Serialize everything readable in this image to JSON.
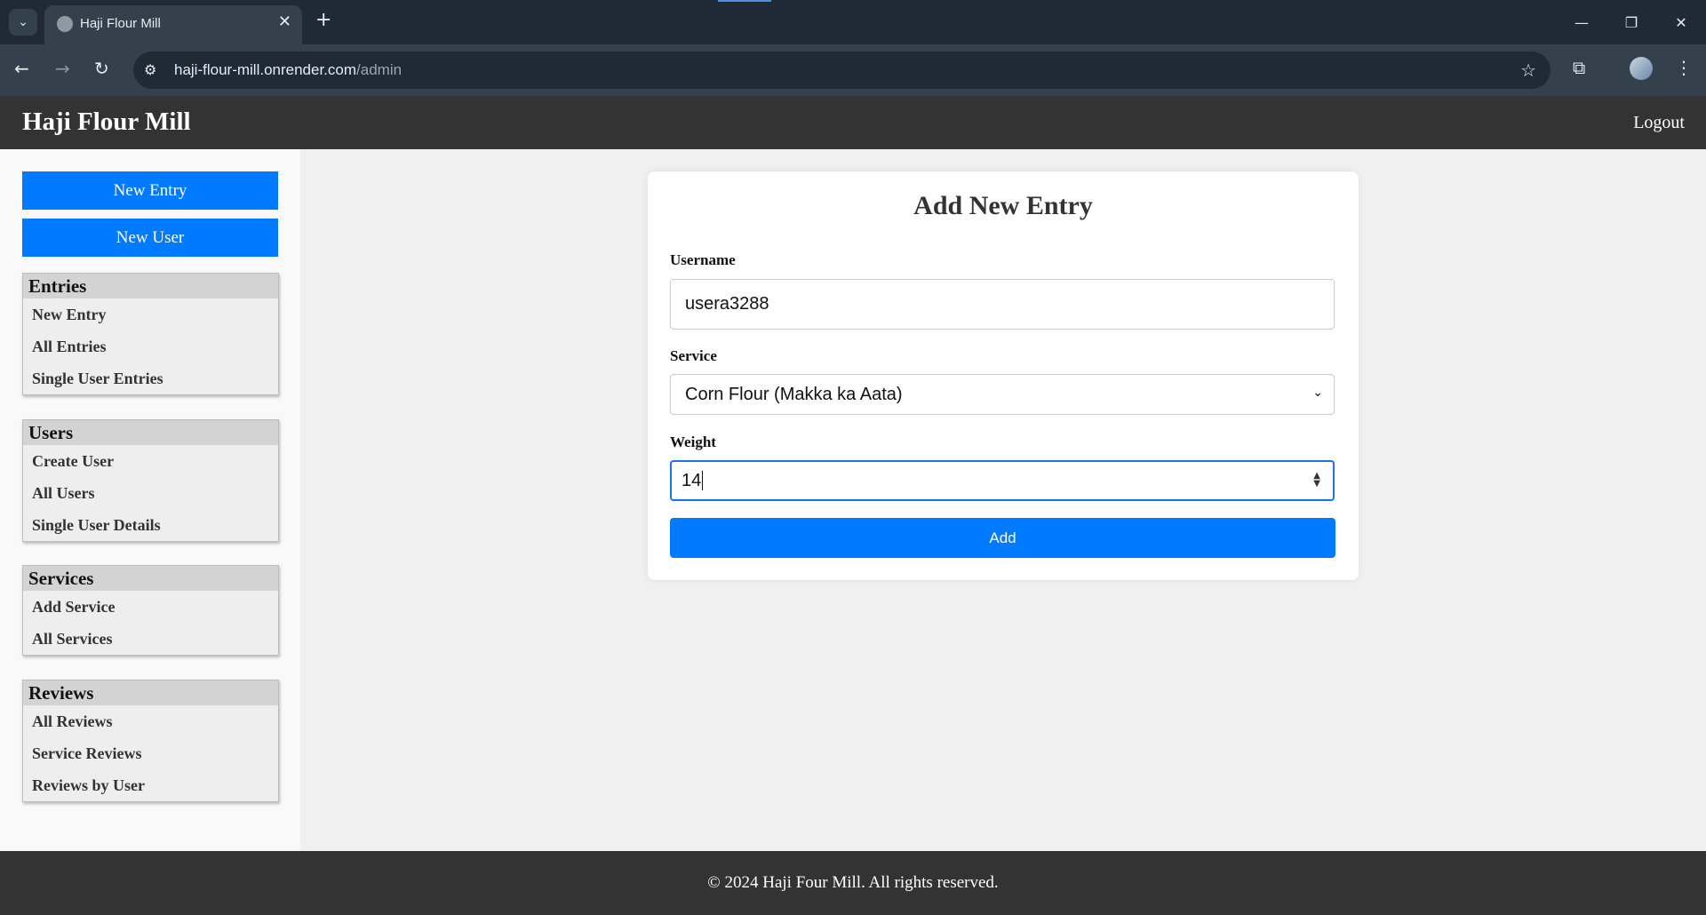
{
  "browser": {
    "tab_title": "Haji Flour Mill",
    "url_host": "haji-flour-mill.onrender.com",
    "url_path": "/admin"
  },
  "header": {
    "brand": "Haji Flour Mill",
    "logout": "Logout"
  },
  "sidebar": {
    "buttons": [
      "New Entry",
      "New User"
    ],
    "groups": [
      {
        "title": "Entries",
        "items": [
          "New Entry",
          "All Entries",
          "Single User Entries"
        ]
      },
      {
        "title": "Users",
        "items": [
          "Create User",
          "All Users",
          "Single User Details"
        ]
      },
      {
        "title": "Services",
        "items": [
          "Add Service",
          "All Services"
        ]
      },
      {
        "title": "Reviews",
        "items": [
          "All Reviews",
          "Service Reviews",
          "Reviews by User"
        ]
      }
    ]
  },
  "form": {
    "title": "Add New Entry",
    "username_label": "Username",
    "username_value": "usera3288",
    "service_label": "Service",
    "service_value": "Corn Flour (Makka ka Aata)",
    "weight_label": "Weight",
    "weight_value": "14",
    "submit_label": "Add"
  },
  "footer": {
    "text": "© 2024 Haji Four Mill. All rights reserved."
  },
  "colors": {
    "primary": "#007bff",
    "header": "#333333",
    "focus": "#1a73e8"
  }
}
